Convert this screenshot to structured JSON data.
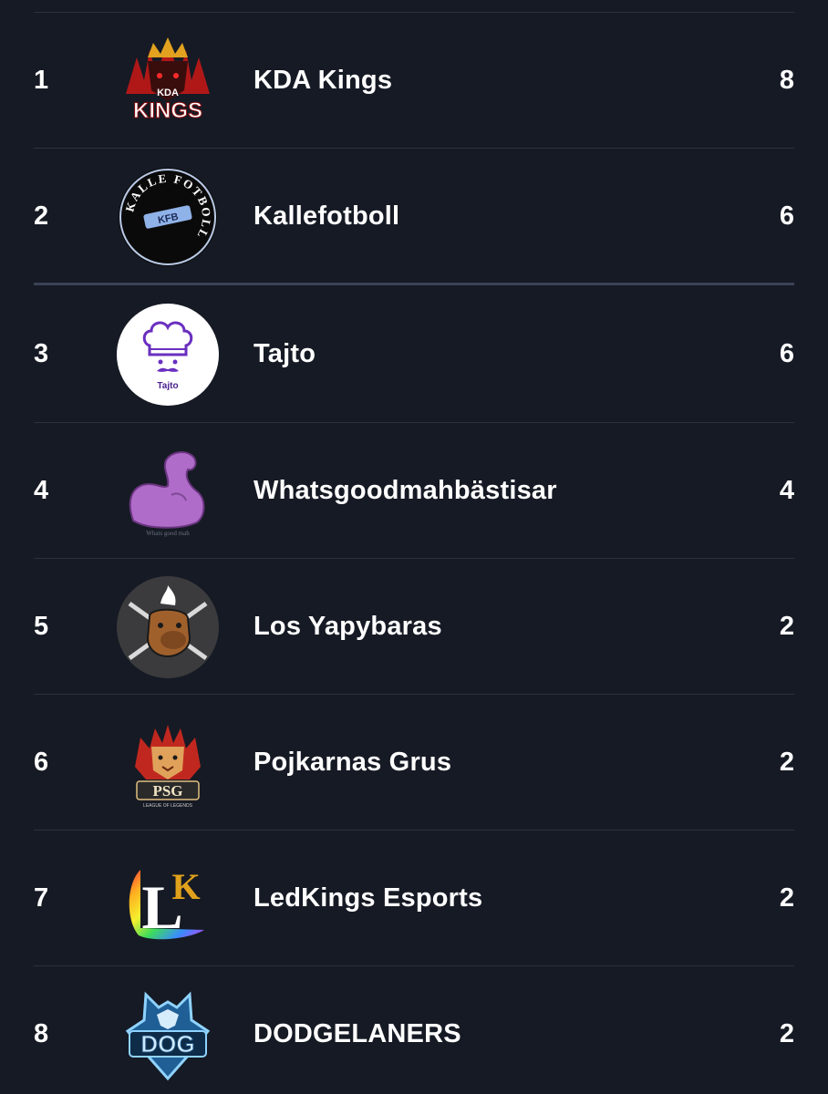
{
  "standings": {
    "rows": [
      {
        "rank": "1",
        "team": "KDA Kings",
        "points": "8",
        "logo": "kda-kings-logo"
      },
      {
        "rank": "2",
        "team": "Kallefotboll",
        "points": "6",
        "logo": "kallefotboll-logo"
      },
      {
        "rank": "3",
        "team": "Tajto",
        "points": "6",
        "logo": "tajto-logo"
      },
      {
        "rank": "4",
        "team": "Whatsgoodmahbästisar",
        "points": "4",
        "logo": "flexed-arm-logo"
      },
      {
        "rank": "5",
        "team": "Los Yapybaras",
        "points": "2",
        "logo": "capybara-logo"
      },
      {
        "rank": "6",
        "team": "Pojkarnas Grus",
        "points": "2",
        "logo": "psg-lion-logo"
      },
      {
        "rank": "7",
        "team": "LedKings Esports",
        "points": "2",
        "logo": "lk-logo"
      },
      {
        "rank": "8",
        "team": "DODGELANERS",
        "points": "2",
        "logo": "dog-wolf-logo"
      }
    ]
  },
  "logo_text": {
    "kda_top": "KDA",
    "kda_main": "KINGS",
    "kalle_ring": "KALLE FOTBOLL",
    "kalle_center": "KFB",
    "tajto": "Tajto",
    "whatsgood": "Whats good mah",
    "psg": "PSG",
    "psg_sub": "LEAGUE OF LEGENDS",
    "lk_l": "L",
    "lk_k": "K",
    "dog": "DOG"
  },
  "colors": {
    "background": "#161a24",
    "divider": "#2b3140",
    "qualification_divider": "#3a4257",
    "text": "#ffffff"
  }
}
